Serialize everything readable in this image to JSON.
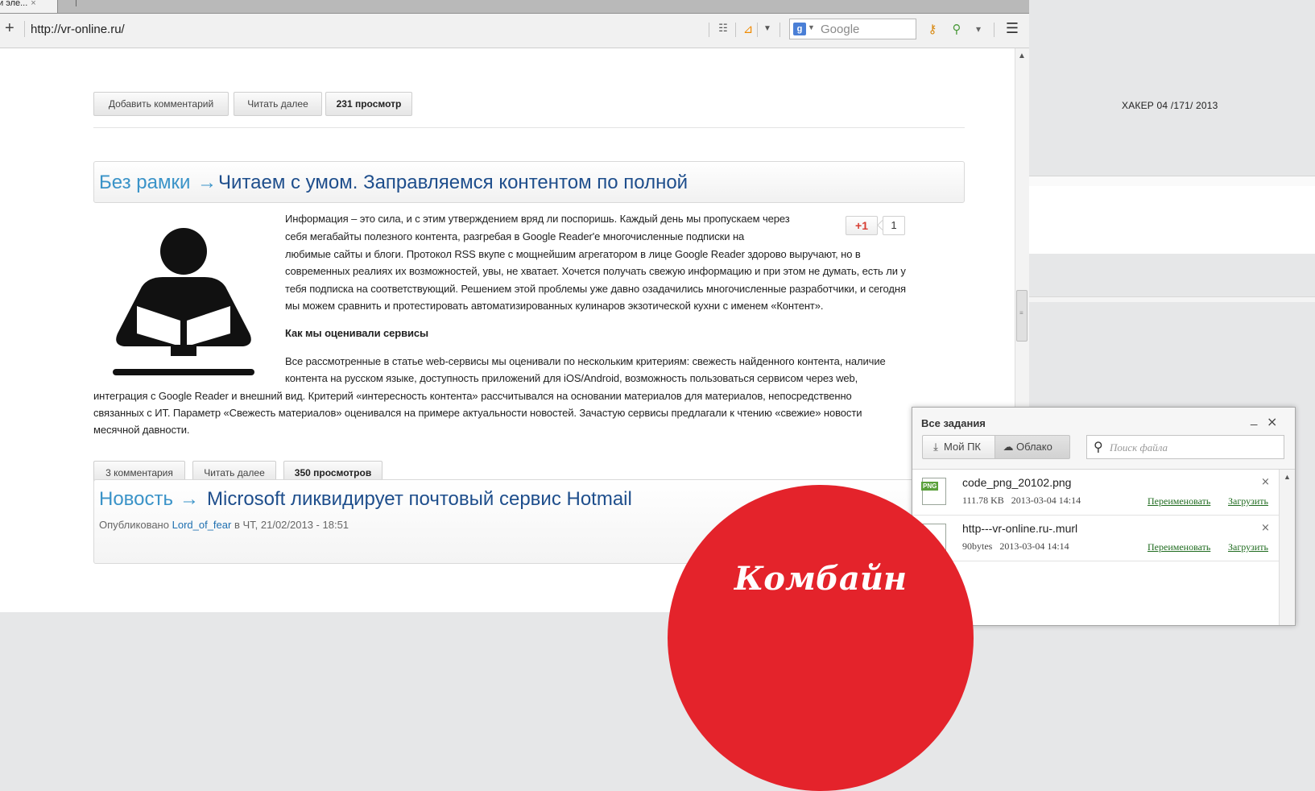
{
  "browser": {
    "tab_title": "и эле...",
    "tab_close": "×",
    "url": "http://vr-online.ru/",
    "add_symbol": "+",
    "search_engine": "Google",
    "icons": [
      "reader-icon",
      "rss-icon",
      "dropdown-icon",
      "key-icon",
      "find-icon",
      "more-icon",
      "menu-icon"
    ]
  },
  "post1": {
    "buttons": [
      "Добавить комментарий",
      "Читать далее",
      "231 просмотр"
    ]
  },
  "article": {
    "category": "Без рамки",
    "arrow": "→",
    "title": "Читаем с умом. Заправляемся контентом по полной",
    "gplus_label": "+1",
    "gplus_count": "1",
    "lines": [
      "Информация – это сила, и с этим утверждением вряд ли поспоришь. Каждый день мы пропускаем через",
      "себя мегабайты полезного контента, разгребая в Google Reader'е многочисленные подписки на",
      "любимые сайты и блоги. Протокол RSS вкупе с мощнейшим агрегатором в лице Google Reader здорово выручают, но в",
      "современных реалиях их возможностей, увы, не хватает. Хочется получать свежую информацию и при этом не думать, есть ли у",
      "тебя подписка на соответствующий. Решением этой проблемы уже давно озадачились многочисленные разработчики, и сегодня",
      "мы можем сравнить и протестировать автоматизированных кулинаров экзотической кухни с именем «Контент»."
    ],
    "subheading": "Как мы оценивали сервисы",
    "lines2": [
      "Все рассмотренные в статье web-сервисы мы оценивали по нескольким критериям: свежесть найденного контента, наличие",
      "контента на русском языке, доступность приложений для iOS/Android, возможность пользоваться сервисом через web,"
    ],
    "lines3": [
      "интеграция с Google Reader и внешний вид. Критерий «интересность контента» рассчитывался на основании материалов для материалов, непосредственно",
      "связанных с ИТ. Параметр «Свежесть материалов» оценивался на примере актуальности новостей. Зачастую сервисы предлагали к чтению «свежие» новости",
      "месячной давности."
    ],
    "buttons": [
      "3 комментария",
      "Читать далее",
      "350 просмотров"
    ]
  },
  "news": {
    "category": "Новость",
    "arrow": "→",
    "title": "Microsoft ликвидирует почтовый сервис Hotmail",
    "meta_prefix": "Опубликовано",
    "author": "Lord_of_fear",
    "meta_suffix": "в ЧТ, 21/02/2013 - 18:51"
  },
  "magazine": {
    "issue": "ХАКЕР 04 /171/ 2013",
    "overlay_label": "Комбайн",
    "overlay_color": "#e4232b"
  },
  "tasks": {
    "title": "Все задания",
    "minimize": "_",
    "close": "×",
    "tab_pc": "Мой ПК",
    "tab_cloud": "Облако",
    "search_placeholder": "Поиск файла",
    "files": [
      {
        "icon": "png-file-icon",
        "badge": "PNG",
        "name": "code_png_20102.png",
        "size": "111.78 KB",
        "date": "2013-03-04 14:14",
        "rename": "Переименовать",
        "download": "Загрузить"
      },
      {
        "icon": "file-icon",
        "badge": "",
        "name": "http---vr-online.ru-.murl",
        "size": "90bytes",
        "date": "2013-03-04 14:14",
        "rename": "Переименовать",
        "download": "Загрузить"
      }
    ]
  }
}
